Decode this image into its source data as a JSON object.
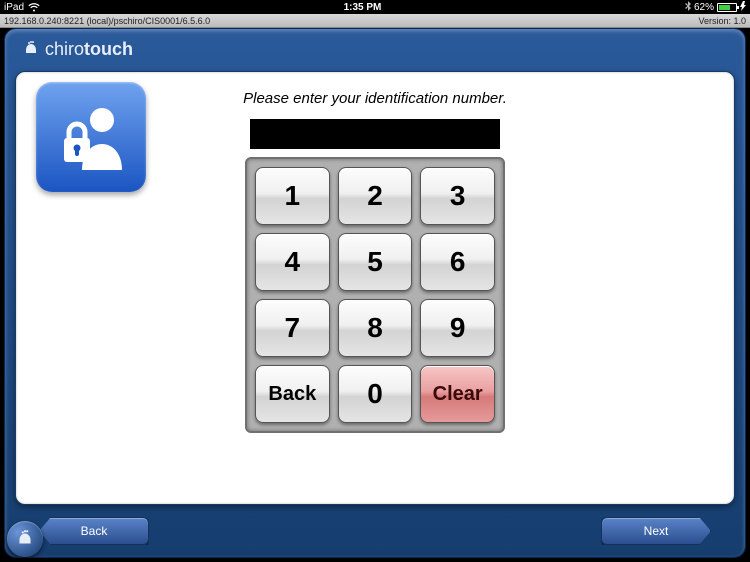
{
  "status": {
    "device": "iPad",
    "time": "1:35 PM",
    "battery_pct": "62%"
  },
  "subbar": {
    "path": "192.168.0.240:8221 (local)/pschiro/CIS0001/6.5.6.0",
    "version": "Version: 1.0"
  },
  "brand": {
    "part1": "chiro",
    "part2": "touch"
  },
  "prompt": "Please enter your identification number.",
  "pin_value": "",
  "keypad": {
    "k1": "1",
    "k2": "2",
    "k3": "3",
    "k4": "4",
    "k5": "5",
    "k6": "6",
    "k7": "7",
    "k8": "8",
    "k9": "9",
    "back": "Back",
    "k0": "0",
    "clear": "Clear"
  },
  "nav": {
    "back": "Back",
    "next": "Next"
  }
}
